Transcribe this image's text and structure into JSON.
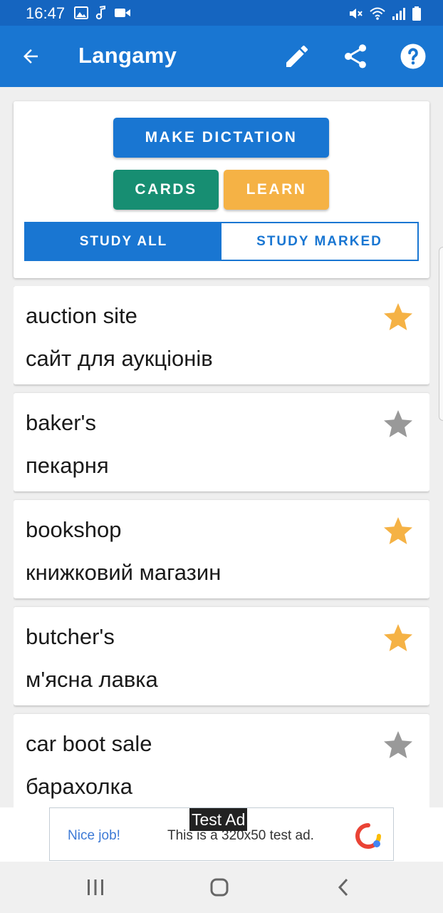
{
  "status_bar": {
    "time": "16:47",
    "left_icons": [
      "image-icon",
      "music-note-icon",
      "video-icon"
    ],
    "right_icons": [
      "mute-icon",
      "wifi-icon",
      "signal-icon",
      "battery-icon"
    ]
  },
  "app_bar": {
    "title": "Langamy",
    "icons": [
      "back-arrow-icon",
      "edit-icon",
      "share-icon",
      "help-icon"
    ]
  },
  "controls": {
    "make_dictation": "MAKE DICTATION",
    "cards": "CARDS",
    "learn": "LEARN",
    "study_all": "STUDY ALL",
    "study_marked": "STUDY MARKED",
    "selected_mode": "STUDY ALL"
  },
  "words": [
    {
      "term": "auction site",
      "translation": "сайт для аукціонів",
      "marked": true
    },
    {
      "term": "baker's",
      "translation": "пекарня",
      "marked": false
    },
    {
      "term": "bookshop",
      "translation": "книжковий магазин",
      "marked": true
    },
    {
      "term": "butcher's",
      "translation": "м'ясна лавка",
      "marked": true
    },
    {
      "term": "car boot sale",
      "translation": "барахолка",
      "marked": false
    }
  ],
  "ad": {
    "label": "Test Ad",
    "nice": "Nice job!",
    "text": "This is a 320x50 test ad."
  },
  "nav_bar": {
    "icons": [
      "recents-icon",
      "home-icon",
      "back-icon"
    ]
  },
  "colors": {
    "primary": "#1976d2",
    "status_bar": "#1565c0",
    "cards_button": "#178e72",
    "learn_button": "#f5b245",
    "star_marked": "#f5b245",
    "star_unmarked": "#999999"
  }
}
